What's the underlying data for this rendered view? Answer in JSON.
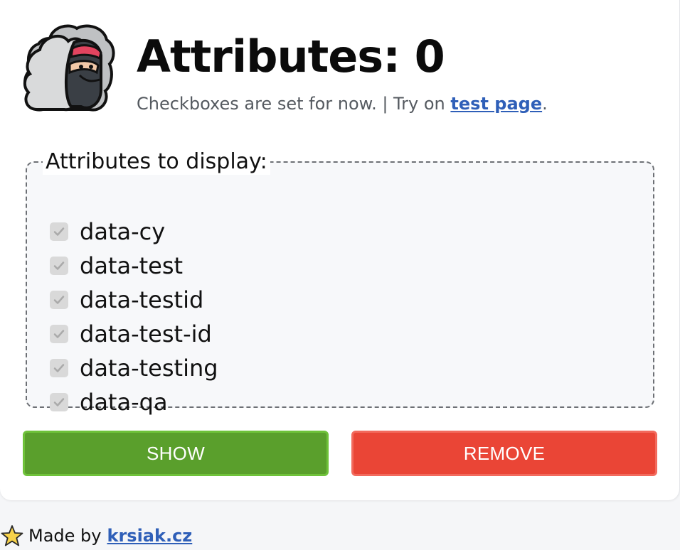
{
  "header": {
    "title_prefix": "Attributes:",
    "count": "0",
    "subtitle_text": "Checkboxes are set for now. | Try on ",
    "subtitle_link": "test page",
    "subtitle_end": "."
  },
  "attributes": {
    "legend": "Attributes to display:",
    "items": [
      {
        "label": "data-cy",
        "checked": true,
        "disabled": true
      },
      {
        "label": "data-test",
        "checked": true,
        "disabled": true
      },
      {
        "label": "data-testid",
        "checked": true,
        "disabled": true
      },
      {
        "label": "data-test-id",
        "checked": true,
        "disabled": true
      },
      {
        "label": "data-testing",
        "checked": true,
        "disabled": true
      },
      {
        "label": "data-qa",
        "checked": true,
        "disabled": true
      }
    ]
  },
  "actions": {
    "show_label": "SHOW",
    "remove_label": "REMOVE"
  },
  "footer": {
    "made_by": "Made by",
    "link": "krsiak.cz"
  },
  "colors": {
    "show": "#5a9f2c",
    "remove": "#ea4536",
    "link": "#2f5fb8"
  },
  "icons": {
    "logo": "ninja-logo-icon",
    "checkbox": "checkmark-icon",
    "footer": "star-icon"
  }
}
